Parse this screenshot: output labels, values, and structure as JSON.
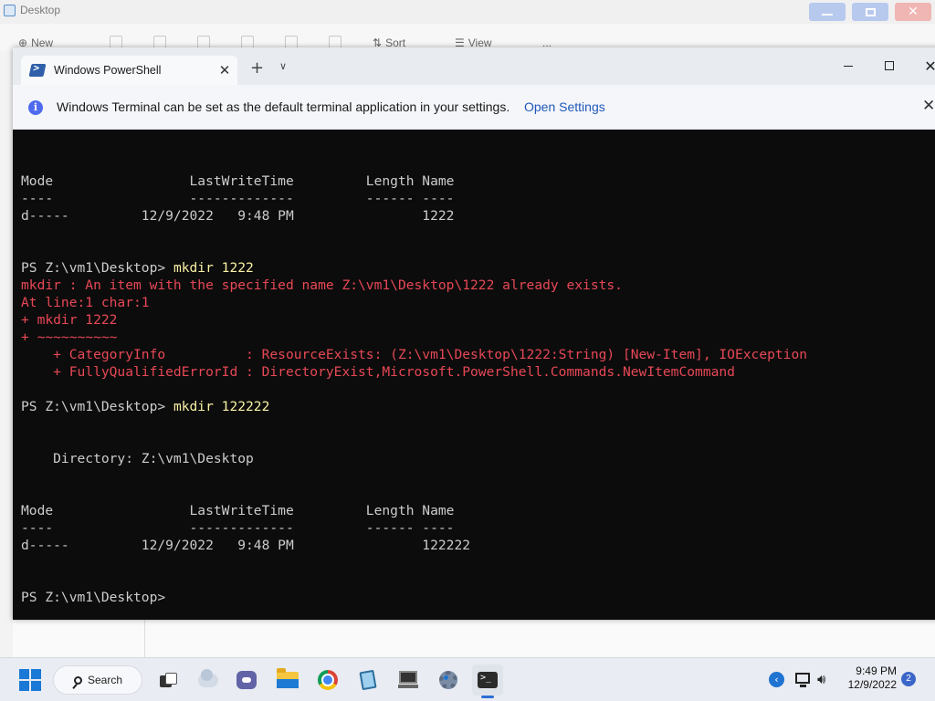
{
  "explorer": {
    "title": "Desktop",
    "toolbar": {
      "new_label": "New",
      "sort_label": "Sort",
      "view_label": "View",
      "more_label": "..."
    }
  },
  "terminal": {
    "tab_title": "Windows PowerShell",
    "infobar": {
      "message": "Windows Terminal can be set as the default terminal application in your settings.",
      "link": "Open Settings"
    },
    "lines": [
      {
        "text": "Mode                 LastWriteTime         Length Name",
        "style": "normal"
      },
      {
        "text": "----                 -------------         ------ ----",
        "style": "normal"
      },
      {
        "text": "d-----         12/9/2022   9:48 PM                1222",
        "style": "normal"
      },
      {
        "text": "PS Z:\\vm1\\Desktop> ",
        "cmd": "mkdir 1222",
        "style": "prompt"
      },
      {
        "text": "mkdir : An item with the specified name Z:\\vm1\\Desktop\\1222 already exists.",
        "style": "error"
      },
      {
        "text": "At line:1 char:1",
        "style": "error"
      },
      {
        "text": "+ mkdir 1222",
        "style": "error"
      },
      {
        "text": "+ ~~~~~~~~~~",
        "style": "error"
      },
      {
        "text": "    + CategoryInfo          : ResourceExists: (Z:\\vm1\\Desktop\\1222:String) [New-Item], IOException",
        "style": "error"
      },
      {
        "text": "    + FullyQualifiedErrorId : DirectoryExist,Microsoft.PowerShell.Commands.NewItemCommand",
        "style": "error"
      },
      {
        "text": "PS Z:\\vm1\\Desktop> ",
        "cmd": "mkdir 122222",
        "style": "prompt"
      },
      {
        "text": "    Directory: Z:\\vm1\\Desktop",
        "style": "normal"
      },
      {
        "text": "Mode                 LastWriteTime         Length Name",
        "style": "normal"
      },
      {
        "text": "----                 -------------         ------ ----",
        "style": "normal"
      },
      {
        "text": "d-----         12/9/2022   9:48 PM                122222",
        "style": "normal"
      },
      {
        "text": "PS Z:\\vm1\\Desktop>",
        "style": "normal"
      }
    ]
  },
  "taskbar": {
    "search_label": "Search",
    "clock_time": "9:49 PM",
    "clock_date": "12/9/2022",
    "notification_count": "2"
  },
  "colors": {
    "terminal_bg": "#0c0c0c",
    "terminal_text": "#cccccc",
    "error_text": "#e74856",
    "command_text": "#f9f1a5",
    "link": "#1f58b8",
    "accent": "#1a78d6"
  }
}
